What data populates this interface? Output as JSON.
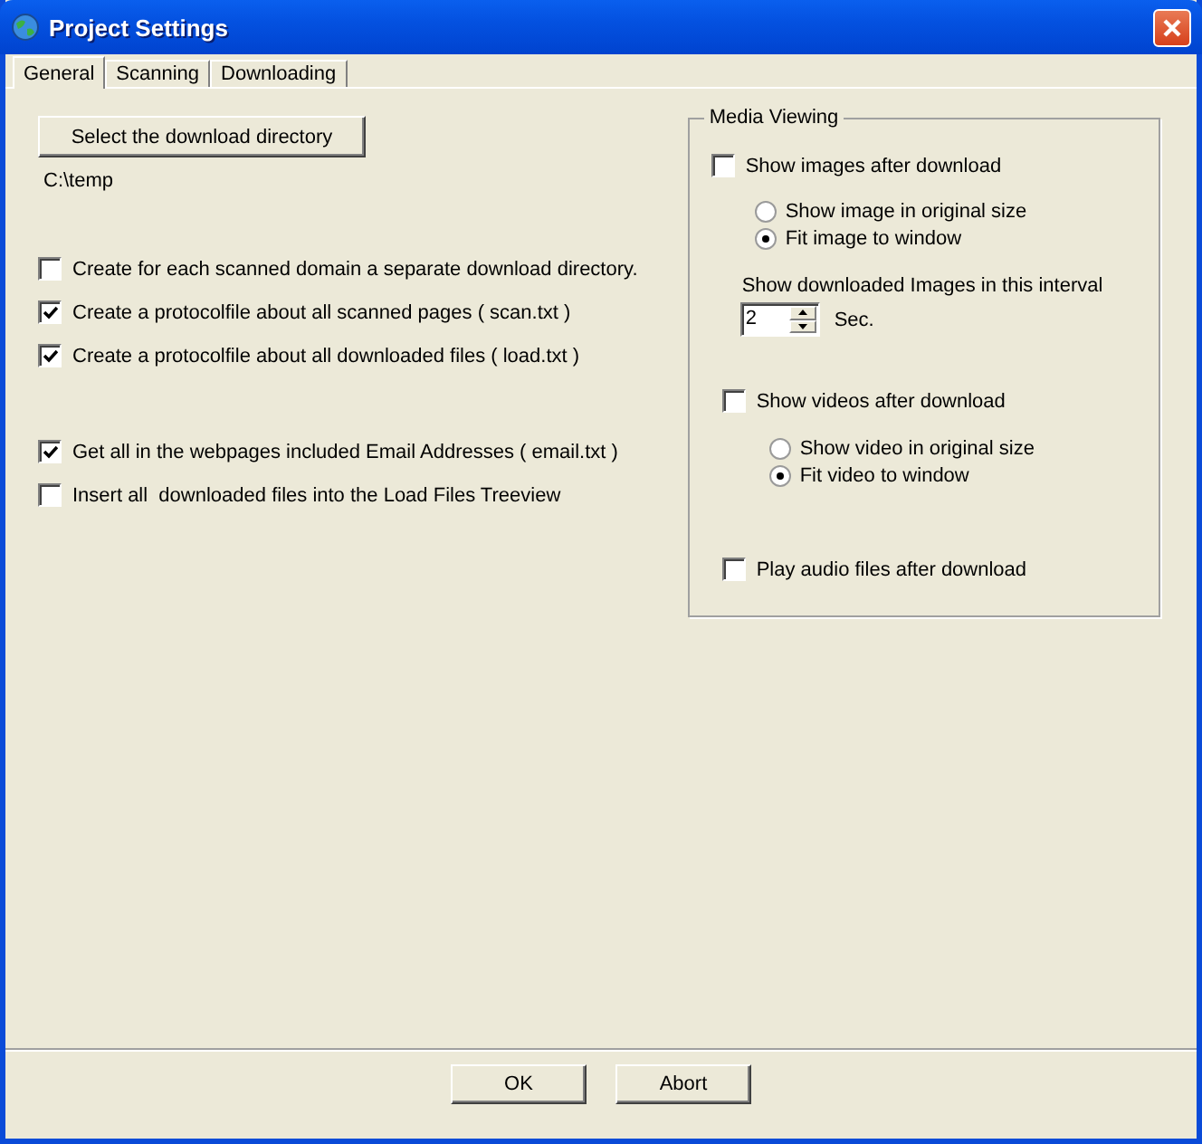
{
  "window": {
    "title": "Project Settings"
  },
  "tabs": [
    {
      "label": "General",
      "selected": true
    },
    {
      "label": "Scanning",
      "selected": false
    },
    {
      "label": "Downloading",
      "selected": false
    }
  ],
  "directory": {
    "button": "Select the download directory",
    "path": "C:\\temp"
  },
  "option_groups": [
    {
      "options": [
        {
          "label": "Create for each scanned domain a separate download directory.",
          "checked": false
        },
        {
          "label": "Create a protocolfile about all scanned pages ( scan.txt )",
          "checked": true
        },
        {
          "label": "Create a protocolfile about all downloaded files ( load.txt )",
          "checked": true
        }
      ]
    },
    {
      "options": [
        {
          "label": "Get all in the webpages included Email Addresses ( email.txt )",
          "checked": true
        },
        {
          "label": "Insert all  downloaded files into the Load Files Treeview",
          "checked": false
        }
      ]
    }
  ],
  "media_viewing": {
    "title": "Media Viewing",
    "images": {
      "label": "Show images after download",
      "checked": false,
      "radios": [
        {
          "label": "Show image in original size",
          "selected": false
        },
        {
          "label": "Fit image to window",
          "selected": true
        }
      ],
      "interval_label": "Show downloaded Images in this interval",
      "interval_value": "2",
      "interval_unit": "Sec."
    },
    "videos": {
      "label": "Show videos after download",
      "checked": false,
      "radios": [
        {
          "label": "Show video in original size",
          "selected": false
        },
        {
          "label": "Fit video to window",
          "selected": true
        }
      ]
    },
    "audio": {
      "label": "Play audio files after download",
      "checked": false
    }
  },
  "buttons": [
    "OK",
    "Abort"
  ]
}
